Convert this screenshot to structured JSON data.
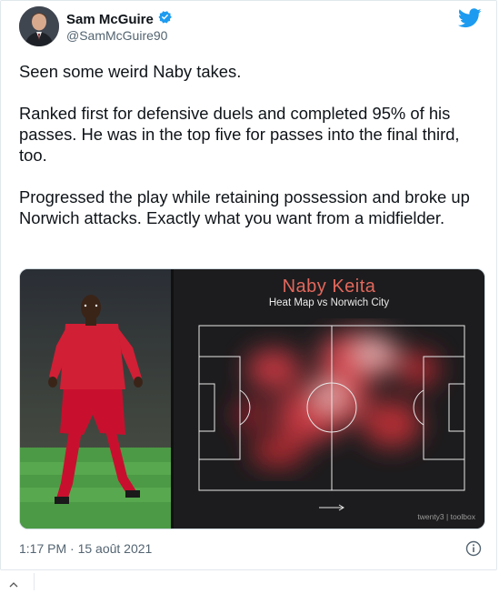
{
  "tweet": {
    "author_name": "Sam McGuire",
    "handle": "@SamMcGuire90",
    "verified": true,
    "paragraphs": [
      "Seen some weird Naby takes.",
      "Ranked first for defensive duels and completed 95% of his passes. He was in the top five for passes into the final third, too.",
      "Progressed the play while retaining possession and broke up Norwich attacks. Exactly what you want from a midfielder."
    ],
    "timestamp": "1:17 PM · 15 août 2021"
  },
  "media": {
    "heatmap_title": "Naby Keita",
    "heatmap_subtitle": "Heat Map vs Norwich City",
    "brand": "twenty3 | toolbox"
  },
  "colors": {
    "twitter_blue": "#1d9bf0",
    "heat_red": "#e2685c",
    "text": "#0f1419",
    "muted": "#536471"
  },
  "icons": [
    "verified-badge-icon",
    "twitter-bird-icon",
    "info-icon",
    "chevron-up-icon"
  ]
}
